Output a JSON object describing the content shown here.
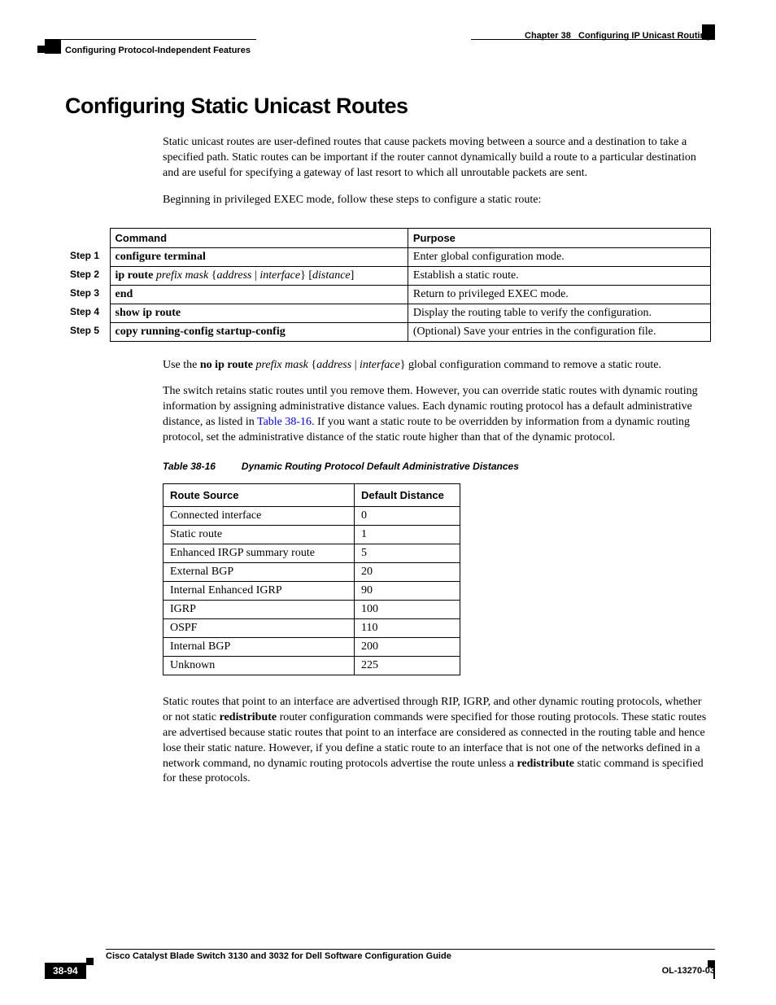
{
  "header": {
    "chapter_label": "Chapter 38",
    "chapter_title": "Configuring IP Unicast Routing",
    "section_title": "Configuring Protocol-Independent Features"
  },
  "title": "Configuring Static Unicast Routes",
  "intro_p1": "Static unicast routes are user-defined routes that cause packets moving between a source and a destination to take a specified path. Static routes can be important if the router cannot dynamically build a route to a particular destination and are useful for specifying a gateway of last resort to which all unroutable packets are sent.",
  "intro_p2": "Beginning in privileged EXEC mode, follow these steps to configure a static route:",
  "cmd_table": {
    "headers": {
      "command": "Command",
      "purpose": "Purpose"
    },
    "rows": [
      {
        "step": "Step 1",
        "cmd_bold": "configure terminal",
        "cmd_italic": "",
        "cmd_tail": "",
        "purpose": "Enter global configuration mode."
      },
      {
        "step": "Step 2",
        "cmd_bold": "ip route",
        "cmd_italic": " prefix mask ",
        "cmd_tail_html": "{<i>address</i> | <i>interface</i>} [<i>distance</i>]",
        "purpose": "Establish a static route."
      },
      {
        "step": "Step 3",
        "cmd_bold": "end",
        "cmd_italic": "",
        "cmd_tail": "",
        "purpose": "Return to privileged EXEC mode."
      },
      {
        "step": "Step 4",
        "cmd_bold": "show ip route",
        "cmd_italic": "",
        "cmd_tail": "",
        "purpose": "Display the routing table to verify the configuration."
      },
      {
        "step": "Step 5",
        "cmd_bold": "copy running-config startup-config",
        "cmd_italic": "",
        "cmd_tail": "",
        "purpose": "(Optional) Save your entries in the configuration file."
      }
    ]
  },
  "para_use_no": {
    "pre": "Use the ",
    "bold1": "no ip route",
    "mid": " ",
    "italic1": "prefix mask",
    "mid2": " {",
    "italic2": "address",
    "mid3": " | ",
    "italic3": "interface",
    "post": "} global configuration command to remove a static route."
  },
  "para_retain_pre": "The switch retains static routes until you remove them. However, you can override static routes with dynamic routing information by assigning administrative distance values. Each dynamic routing protocol has a default administrative distance, as listed in ",
  "para_retain_link": "Table 38-16",
  "para_retain_post": ". If you want a static route to be overridden by information from a dynamic routing protocol, set the administrative distance of the static route higher than that of the dynamic protocol.",
  "table_caption": {
    "num": "Table 38-16",
    "title": "Dynamic Routing Protocol Default Administrative Distances"
  },
  "dist_table": {
    "headers": {
      "source": "Route Source",
      "distance": "Default Distance"
    },
    "rows": [
      {
        "source": "Connected interface",
        "distance": "0"
      },
      {
        "source": "Static route",
        "distance": "1"
      },
      {
        "source": "Enhanced IRGP summary route",
        "distance": "5"
      },
      {
        "source": "External BGP",
        "distance": "20"
      },
      {
        "source": "Internal Enhanced IGRP",
        "distance": "90"
      },
      {
        "source": "IGRP",
        "distance": "100"
      },
      {
        "source": "OSPF",
        "distance": "110"
      },
      {
        "source": "Internal BGP",
        "distance": "200"
      },
      {
        "source": "Unknown",
        "distance": "225"
      }
    ]
  },
  "para_static_pre": "Static routes that point to an interface are advertised through RIP, IGRP, and other dynamic routing protocols, whether or not static ",
  "para_static_bold1": "redistribute",
  "para_static_mid": " router configuration commands were specified for those routing protocols. These static routes are advertised because static routes that point to an interface are considered as connected in the routing table and hence lose their static nature. However, if you define a static route to an interface that is not one of the networks defined in a network command, no dynamic routing protocols advertise the route unless a ",
  "para_static_bold2": "redistribute",
  "para_static_post": " static command is specified for these protocols.",
  "footer": {
    "guide_title": "Cisco Catalyst Blade Switch 3130 and 3032 for Dell Software Configuration Guide",
    "page": "38-94",
    "doc_id": "OL-13270-03"
  }
}
